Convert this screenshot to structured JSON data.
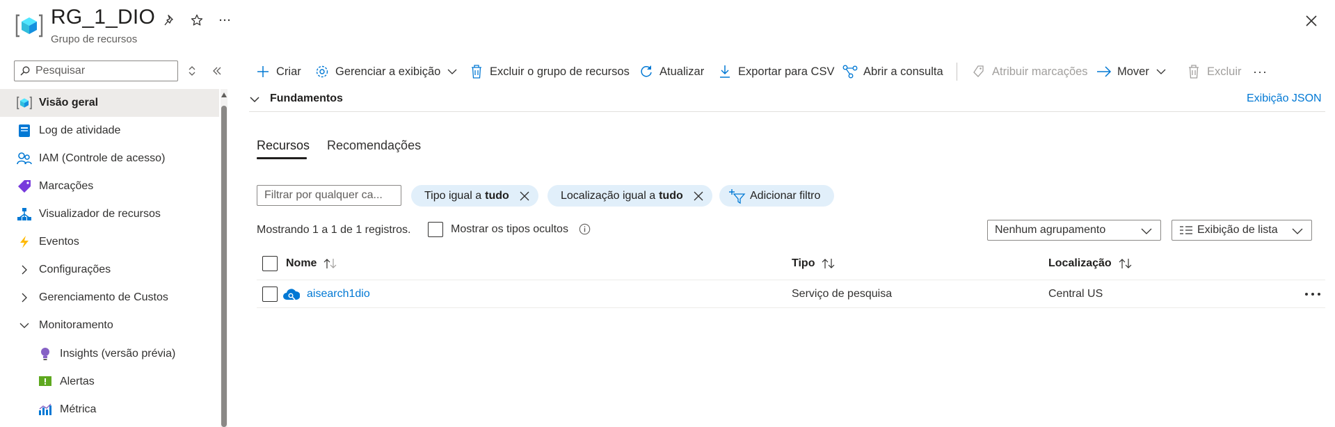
{
  "header": {
    "title": "RG_1_DIO",
    "subtitle": "Grupo de recursos",
    "icons": [
      "resource-group-icon",
      "pin-icon",
      "star-icon",
      "more-icon",
      "close-icon"
    ]
  },
  "sidebar": {
    "search_placeholder": "Pesquisar",
    "items": [
      {
        "label": "Visão geral",
        "icon": "overview-icon",
        "active": true
      },
      {
        "label": "Log de atividade",
        "icon": "activity-log-icon"
      },
      {
        "label": "IAM (Controle de acesso)",
        "icon": "iam-icon"
      },
      {
        "label": "Marcações",
        "icon": "tag-icon"
      },
      {
        "label": "Visualizador de recursos",
        "icon": "resource-visualizer-icon"
      },
      {
        "label": "Eventos",
        "icon": "lightning-icon"
      },
      {
        "label": "Configurações",
        "icon": "chevron-right-icon"
      },
      {
        "label": "Gerenciamento de Custos",
        "icon": "chevron-right-icon"
      },
      {
        "label": "Monitoramento",
        "icon": "chevron-down-icon"
      },
      {
        "label": "Insights (versão prévia)",
        "icon": "bulb-icon"
      },
      {
        "label": "Alertas",
        "icon": "alert-icon"
      },
      {
        "label": "Métrica",
        "icon": "metric-icon"
      }
    ]
  },
  "toolbar": {
    "create": "Criar",
    "manage_view": "Gerenciar a exibição",
    "delete_group": "Excluir o grupo de recursos",
    "refresh": "Atualizar",
    "export_csv": "Exportar para CSV",
    "open_query": "Abrir a consulta",
    "assign_tags": "Atribuir marcações",
    "move": "Mover",
    "delete": "Excluir",
    "more": "···"
  },
  "essentials": {
    "label": "Fundamentos",
    "json_view": "Exibição JSON"
  },
  "tabs": [
    {
      "label": "Recursos",
      "active": true
    },
    {
      "label": "Recomendações"
    }
  ],
  "filters": {
    "placeholder": "Filtrar por qualquer ca...",
    "pills": [
      {
        "prefix": "Tipo igual a",
        "value": "tudo"
      },
      {
        "prefix": "Localização igual a",
        "value": "tudo"
      }
    ],
    "add_filter": "Adicionar filtro"
  },
  "records": {
    "summary": "Mostrando 1 a 1 de 1 registros.",
    "show_hidden": "Mostrar os tipos ocultos",
    "grouping": "Nenhum agrupamento",
    "view": "Exibição de lista"
  },
  "table": {
    "columns": [
      "Nome",
      "Tipo",
      "Localização"
    ],
    "rows": [
      {
        "name": "aisearch1dio",
        "type": "Serviço de pesquisa",
        "location": "Central US",
        "icon": "search-service-icon"
      }
    ]
  },
  "colors": {
    "accent": "#0078d4",
    "pill_bg": "#e1effa",
    "active_bg": "#edebe9"
  }
}
